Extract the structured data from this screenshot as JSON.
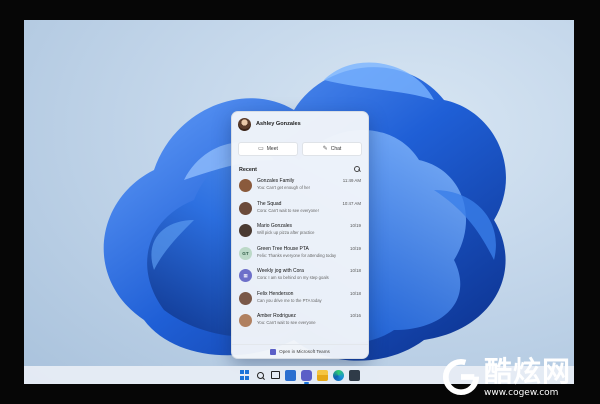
{
  "flyout": {
    "user_name": "Ashley Gonzales",
    "meet_label": "Meet",
    "chat_label": "Chat",
    "recent_label": "Recent",
    "chats": [
      {
        "name": "Gonzales Family",
        "time": "11:49 AM",
        "preview": "You: Can't get enough of her",
        "avatar_color": "#8a5a3c",
        "initials": ""
      },
      {
        "name": "The Squad",
        "time": "10:47 AM",
        "preview": "Cora: Can't wait to see everyone!",
        "avatar_color": "#6b4a3a",
        "initials": ""
      },
      {
        "name": "Mario Gonzales",
        "time": "10/19",
        "preview": "Will pick up pizza after practice",
        "avatar_color": "#4a3a32",
        "initials": ""
      },
      {
        "name": "Green Tree House PTA",
        "time": "10/19",
        "preview": "Felix: Thanks everyone for attending today",
        "avatar_color": "#bcd9c8",
        "initials": "GT"
      },
      {
        "name": "Weekly jog with Cora",
        "time": "10/18",
        "preview": "Cora: I am so behind on my step goals",
        "avatar_color": "#6d6fc9",
        "initials": ""
      },
      {
        "name": "Felix Henderson",
        "time": "10/18",
        "preview": "Can you drive me to the PTA today",
        "avatar_color": "#7a5848",
        "initials": ""
      },
      {
        "name": "Amber Rodriguez",
        "time": "10/16",
        "preview": "You: Can't wait to see everyone",
        "avatar_color": "#b08060",
        "initials": ""
      }
    ],
    "footer_label": "Open in Microsoft Teams"
  },
  "taskbar": {
    "icons": [
      "windows-start-icon",
      "search-icon",
      "task-view-icon",
      "widgets-icon",
      "teams-chat-icon",
      "file-explorer-icon",
      "edge-icon",
      "store-icon"
    ]
  },
  "watermark": {
    "title": "酷炫网",
    "url": "www.cogew.com"
  },
  "colors": {
    "accent": "#1a73d9",
    "teams": "#5b5fc7",
    "wallpaper_bloom": "#1f5fd6"
  }
}
